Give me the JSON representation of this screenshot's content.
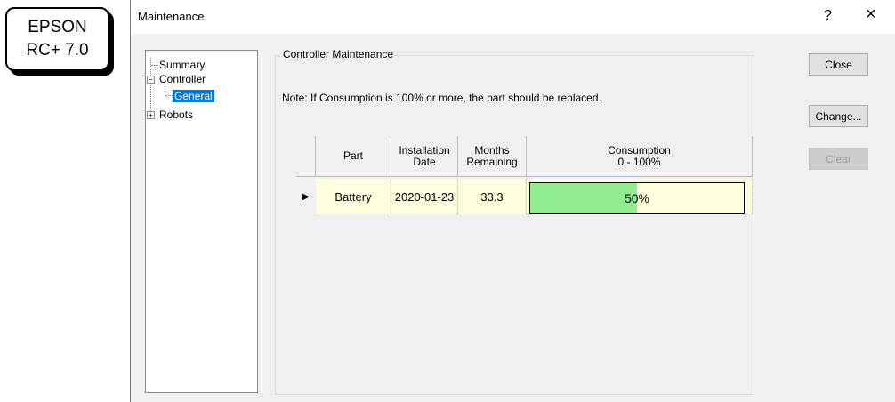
{
  "logo": {
    "line1": "EPSON",
    "line2": "RC+ 7.0"
  },
  "window": {
    "title": "Maintenance",
    "help": "?",
    "close": "×"
  },
  "tree": {
    "items": [
      {
        "label": "Summary"
      },
      {
        "label": "Controller",
        "expander": "−"
      },
      {
        "label": "General",
        "selected": true
      },
      {
        "label": "Robots",
        "expander": "+"
      }
    ]
  },
  "group": {
    "label": "Controller Maintenance",
    "note": "Note: If Consumption is 100% or more, the part should be replaced."
  },
  "grid": {
    "headers": {
      "part": "Part",
      "install_1": "Installation",
      "install_2": "Date",
      "months_1": "Months",
      "months_2": "Remaining",
      "consumption_1": "Consumption",
      "consumption_2": "0 - 100%"
    },
    "rows": [
      {
        "part": "Battery",
        "installation_date": "2020-01-23",
        "months_remaining": "33.3",
        "consumption_label": "50%",
        "consumption": 50
      }
    ],
    "row_indicator": "▶"
  },
  "buttons": {
    "close": "Close",
    "change": "Change...",
    "clear": "Clear"
  },
  "colors": {
    "progress_fill": "#90ee90",
    "row_background": "#ffffe0",
    "selection": "#0078d7"
  }
}
